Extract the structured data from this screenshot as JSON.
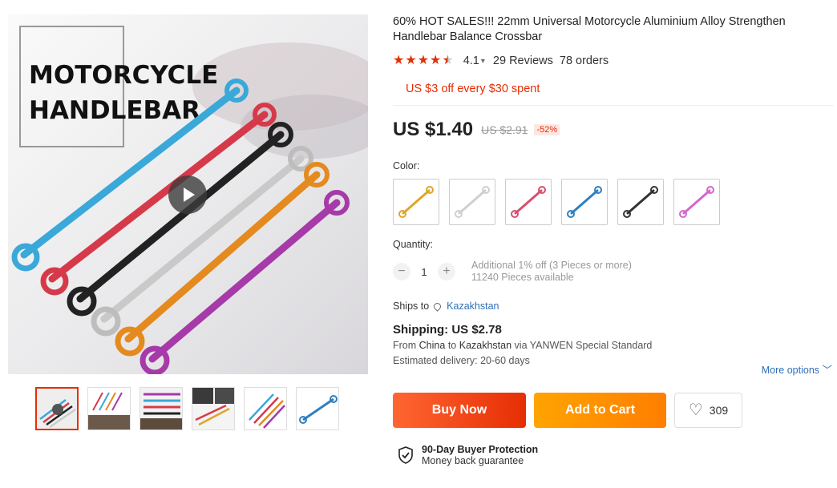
{
  "gallery": {
    "banner_line1": "MOTORCYCLE",
    "banner_line2": "HANDLEBAR",
    "thumb_count": 6
  },
  "product": {
    "title": "60% HOT SALES!!! 22mm Universal Motorcycle Aluminium Alloy Strengthen Handlebar Balance Crossbar",
    "rating": "4.1",
    "rating_stars": 4.1,
    "reviews": "29 Reviews",
    "orders": "78 orders",
    "coupon": "US $3 off every $30 spent",
    "price": "US $1.40",
    "old_price": "US $2.91",
    "discount": "-52%",
    "color_label": "Color:",
    "colors": [
      "#e0a528",
      "#cfcfcf",
      "#d65070",
      "#2f7fc0",
      "#333333",
      "#d466c8"
    ],
    "quantity_label": "Quantity:",
    "quantity": "1",
    "qty_info1": "Additional 1% off (3 Pieces or more)",
    "qty_info2": "11240 Pieces available"
  },
  "shipping": {
    "ships_to_label": "Ships to",
    "ships_to": "Kazakhstan",
    "cost": "Shipping: US $2.78",
    "from_label": "From",
    "from": "China",
    "to_label": "to",
    "to": "Kazakhstan",
    "via": "via YANWEN Special Standard",
    "delivery": "Estimated delivery: 20-60 days",
    "more_options": "More options ﹀"
  },
  "actions": {
    "buy_now": "Buy Now",
    "add_to_cart": "Add to Cart",
    "wishlist_count": "309"
  },
  "protection": {
    "title": "90-Day Buyer Protection",
    "subtitle": "Money back guarantee"
  },
  "colors": {
    "accent": "#e62e04",
    "link": "#2e6fb7",
    "cart": "#ff8c00"
  }
}
